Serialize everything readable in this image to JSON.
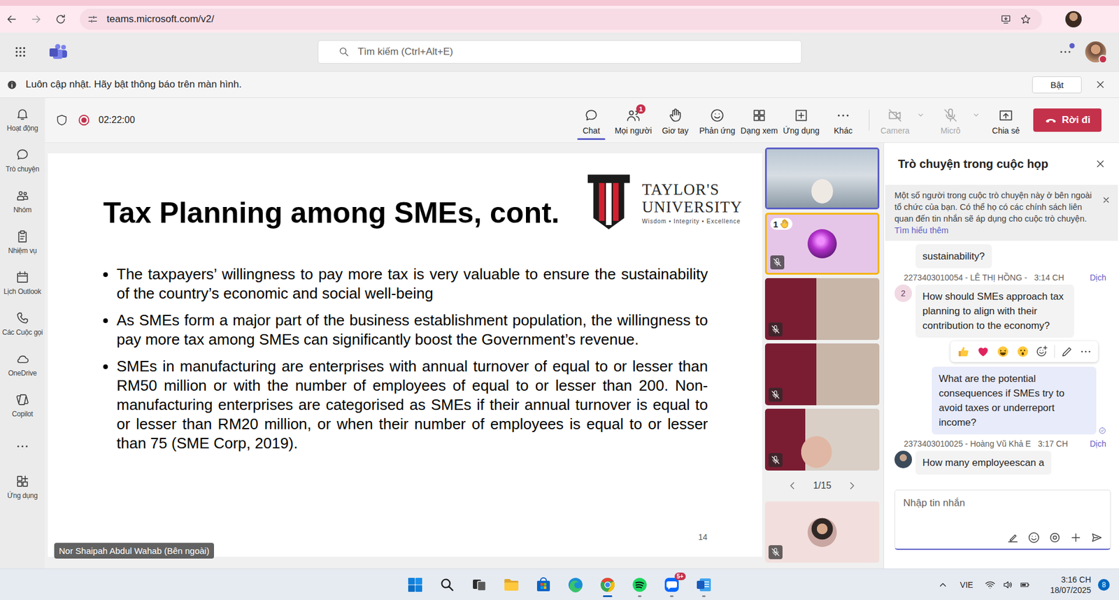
{
  "browser": {
    "url": "teams.microsoft.com/v2/"
  },
  "app_bar": {
    "search_placeholder": "Tìm kiếm (Ctrl+Alt+E)",
    "more_unread": true,
    "presence": "busy"
  },
  "notice_bar": {
    "text": "Luôn cập nhật. Hãy bật thông báo trên màn hình.",
    "button": "Bật"
  },
  "rail": [
    {
      "label": "Hoạt động",
      "kind": "bell"
    },
    {
      "label": "Trò chuyện",
      "kind": "chat"
    },
    {
      "label": "Nhóm",
      "kind": "teams"
    },
    {
      "label": "Nhiệm vụ",
      "kind": "tasks"
    },
    {
      "label": "Lịch Outlook",
      "kind": "calendar"
    },
    {
      "label": "Các Cuộc gọi",
      "kind": "calls"
    },
    {
      "label": "OneDrive",
      "kind": "cloud"
    },
    {
      "label": "Copilot",
      "kind": "copilot"
    },
    {
      "kind": "more"
    },
    {
      "label": "Ứng dụng",
      "kind": "apps"
    }
  ],
  "meeting_bar": {
    "recording": true,
    "timer": "02:22:00",
    "buttons": [
      {
        "label": "Chat",
        "kind": "chat",
        "selected": true
      },
      {
        "label": "Mọi người",
        "kind": "people",
        "selected": false,
        "badge": "1"
      },
      {
        "label": "Giơ tay",
        "kind": "hand",
        "selected": false
      },
      {
        "label": "Phản ứng",
        "kind": "smile",
        "selected": false
      },
      {
        "label": "Dạng xem",
        "kind": "grid",
        "selected": false
      },
      {
        "label": "Ứng dụng",
        "kind": "plus",
        "selected": false
      },
      {
        "label": "Khác",
        "kind": "more",
        "selected": false
      }
    ],
    "devices": [
      {
        "label": "Camera",
        "kind": "camera-off",
        "disabled": true,
        "dropdown": true
      },
      {
        "label": "Micrô",
        "kind": "mic-off",
        "disabled": true,
        "dropdown": true
      },
      {
        "label": "Chia sẻ",
        "kind": "share",
        "disabled": false,
        "dropdown": false
      }
    ],
    "leave": "Rời đi"
  },
  "slide": {
    "title": "Tax Planning among SMEs, cont.",
    "logo": {
      "name": "TAYLOR'S",
      "sub": "UNIVERSITY",
      "motto": "Wisdom • Integrity • Excellence"
    },
    "bullets": [
      "The taxpayers’ willingness to pay more tax is very valuable to ensure the sustainability of the country’s economic and social well-being",
      "As SMEs form a major part of the business establishment population, the willingness to pay more tax among SMEs can significantly boost the Government’s revenue.",
      "SMEs in manufacturing are enterprises with annual turnover of equal to or lesser than RM50 million or with the number of employees of equal to or lesser than 200. Non-manufacturing enterprises are categorised as SMEs if their annual turnover is equal to or lesser than RM20 million, or when their number of employees is equal to or lesser than 75 (SME Corp, 2019)."
    ],
    "page": "14",
    "presenter": "Nor Shaipah Abdul Wahab (Bên ngoài)"
  },
  "participants": {
    "tiles": [
      {
        "kind": "video",
        "muted": false,
        "speaking": true
      },
      {
        "kind": "avatar",
        "muted": true,
        "speaking": false,
        "hand": "1"
      },
      {
        "kind": "video",
        "muted": true,
        "speaking": false
      },
      {
        "kind": "video",
        "muted": true,
        "speaking": false
      },
      {
        "kind": "video",
        "muted": true,
        "speaking": false
      }
    ],
    "pager": "1/15",
    "self": {
      "kind": "avatar",
      "muted": true
    }
  },
  "chat": {
    "title": "Trò chuyện trong cuộc họp",
    "notice": {
      "text": "Một số người trong cuộc trò chuyện này ở bên ngoài tổ chức của bạn. Có thể họ có các chính sách liên quan đến tin nhắn sẽ áp dụng cho cuộc trò chuyện.",
      "link": "Tìm hiểu thêm"
    },
    "messages": [
      {
        "kind": "other",
        "text": "sustainability?"
      },
      {
        "kind": "other",
        "author": "2273403010054 - LÊ THỊ HỒNG -",
        "time": "3:14 CH",
        "translate": "Dịch",
        "avatar": "2",
        "text": "How should SMEs approach tax planning to align with their contribution to the economy?",
        "reactions_open": true
      },
      {
        "kind": "mine",
        "text": "What are the potential consequences if SMEs try to avoid taxes or underreport income?",
        "seen": true
      },
      {
        "kind": "other",
        "author": "2373403010025 - Hoàng Vũ Khả E",
        "time": "3:17 CH",
        "translate": "Dịch",
        "text": "How many employeescan a"
      }
    ],
    "input_placeholder": "Nhập tin nhắn"
  },
  "taskbar": {
    "apps": [
      {
        "kind": "start",
        "running": false,
        "active": false
      },
      {
        "kind": "search",
        "running": false,
        "active": false
      },
      {
        "kind": "taskview",
        "running": false,
        "active": false
      },
      {
        "kind": "explorer",
        "running": false,
        "active": false
      },
      {
        "kind": "store",
        "running": false,
        "active": false
      },
      {
        "kind": "edge",
        "running": false,
        "active": false
      },
      {
        "kind": "chrome",
        "running": true,
        "active": true
      },
      {
        "kind": "spotify",
        "running": true,
        "active": false
      },
      {
        "kind": "zalo",
        "running": true,
        "active": false,
        "badge": "5+"
      },
      {
        "kind": "word",
        "running": true,
        "active": false
      }
    ],
    "tray": {
      "language": "VIE",
      "time": "3:16 CH",
      "date": "18/07/2025",
      "notifications": "8"
    }
  }
}
